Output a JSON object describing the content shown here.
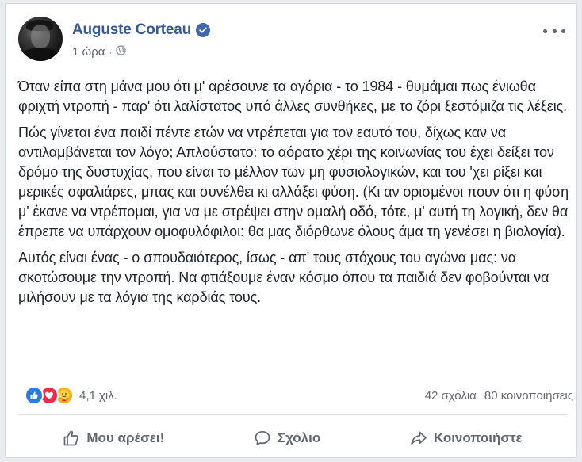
{
  "post": {
    "author": "Auguste Corteau",
    "time": "1 ώρα",
    "paragraphs": [
      "Όταν είπα στη μάνα μου ότι μ' αρέσουνε τα αγόρια - το 1984 - θυμάμαι πως ένιωθα φριχτή ντροπή - παρ' ότι λαλίστατος υπό άλλες συνθήκες, με το ζόρι ξεστόμιζα τις λέξεις.",
      "Πώς γίνεται ένα παιδί πέντε ετών να ντρέπεται για τον εαυτό του, δίχως καν να αντιλαμβάνεται τον λόγο; Απλούστατο: το αόρατο χέρι της κοινωνίας του έχει δείξει τον δρόμο της δυστυχίας, που είναι το μέλλον των μη φυσιολογικών, και του 'χει ρίξει και μερικές σφαλιάρες, μπας και συνέλθει κι αλλάξει φύση. (Κι αν ορισμένοι πουν ότι η φύση μ' έκανε να ντρέπομαι, για να με στρέψει στην ομαλή οδό, τότε, μ' αυτή τη λογική, δεν θα έπρεπε να υπάρχουν ομοφυλόφιλοι: θα μας διόρθωνε όλους άμα τη γενέσει η βιολογία).",
      "Αυτός είναι ένας - ο σπουδαιότερος, ίσως - απ' τους στόχους του αγώνα μας: να σκοτώσουμε την ντροπή. Να φτιάξουμε έναν κόσμο όπου τα παιδιά δεν φοβούνται να μιλήσουν με τα λόγια της καρδιάς τους."
    ]
  },
  "reactions": {
    "icons": [
      "like-icon",
      "love-icon",
      "care-icon"
    ],
    "count": "4,1 χιλ.",
    "comments": "42 σχόλια",
    "shares": "80 κοινοποιήσεις"
  },
  "actions": {
    "like": "Μου αρέσει!",
    "comment": "Σχόλιο",
    "share": "Κοινοποιήστε"
  },
  "colors": {
    "author": "#365899",
    "verified": "#4267b2",
    "text": "#1d2129",
    "muted": "#616770"
  }
}
